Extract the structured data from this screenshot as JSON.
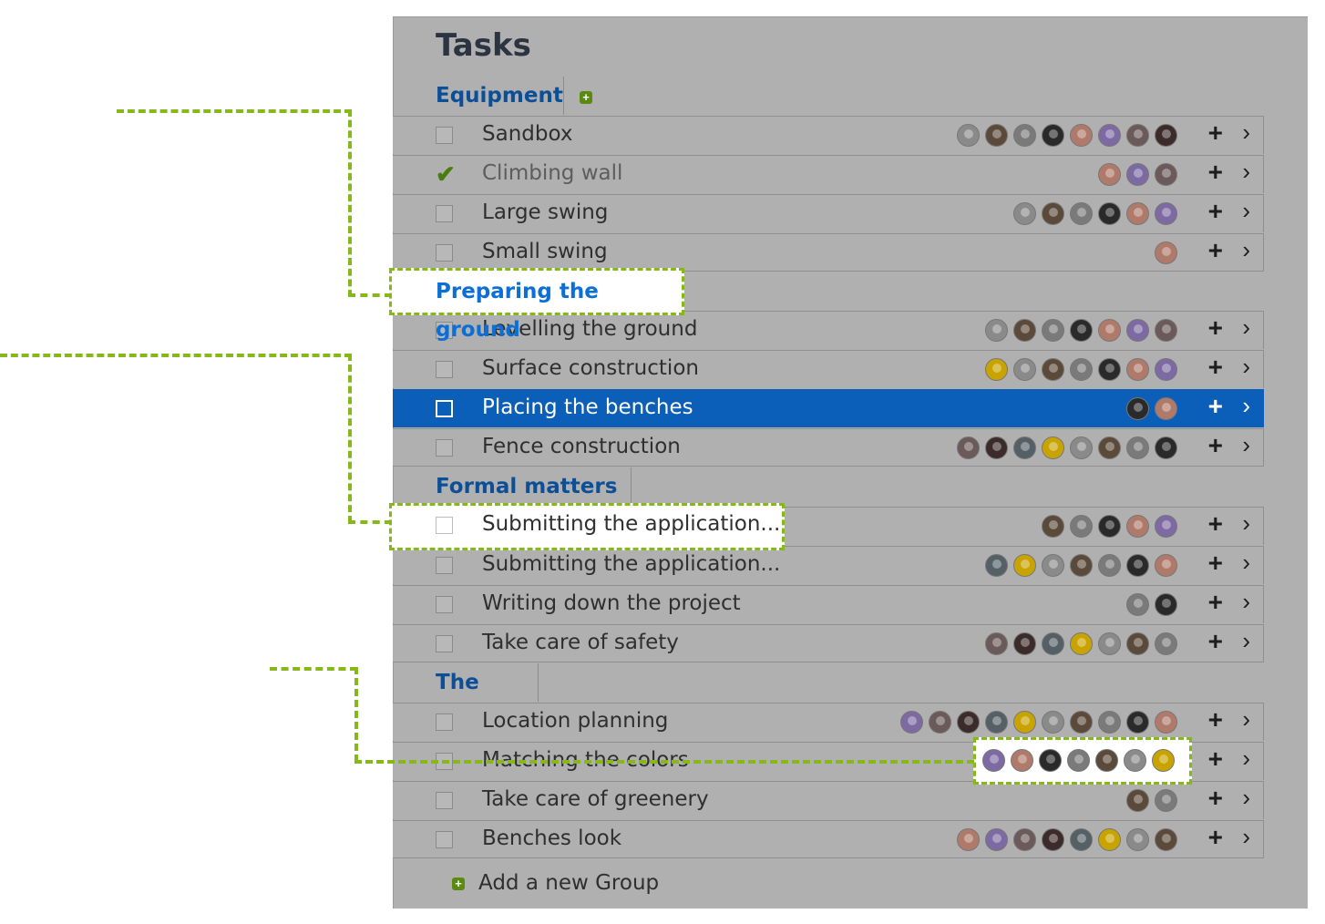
{
  "title": "Tasks",
  "colors": {
    "accent": "#86b81c",
    "selected": "#0b5fb8",
    "group": "#0d4f97"
  },
  "icons": {
    "add_group": "plus-square-icon",
    "add_task": "plus-icon",
    "open": "chevron-right-icon",
    "done": "check-icon"
  },
  "groups": [
    {
      "name": "Equipment",
      "tasks": [
        {
          "name": "Sandbox",
          "done": false,
          "avatars": 8
        },
        {
          "name": "Climbing wall",
          "done": true,
          "avatars": 3
        },
        {
          "name": "Large swing",
          "done": false,
          "avatars": 6
        },
        {
          "name": "Small swing",
          "done": false,
          "avatars": 1
        }
      ]
    },
    {
      "name": "Preparing the ground",
      "tasks": [
        {
          "name": "Levelling the ground",
          "done": false,
          "avatars": 7
        },
        {
          "name": "Surface construction",
          "done": false,
          "avatars": 7
        },
        {
          "name": "Placing the benches",
          "done": false,
          "selected": true,
          "avatars": 2
        },
        {
          "name": "Fence construction",
          "done": false,
          "avatars": 8
        }
      ]
    },
    {
      "name": "Formal matters",
      "tasks": [
        {
          "name": "Submitting the application...",
          "done": false,
          "avatars": 5
        },
        {
          "name": "Submitting the application...",
          "done": false,
          "avatars": 7
        },
        {
          "name": "Writing down the project",
          "done": false,
          "avatars": 2
        },
        {
          "name": "Take care of safety",
          "done": false,
          "avatars": 7
        }
      ]
    },
    {
      "name": "The Look",
      "tasks": [
        {
          "name": "Location planning",
          "done": false,
          "avatars": 10
        },
        {
          "name": "Matching the colors",
          "done": false,
          "avatars": 7
        },
        {
          "name": "Take care of greenery",
          "done": false,
          "avatars": 2
        },
        {
          "name": "Benches look",
          "done": false,
          "avatars": 8
        }
      ]
    }
  ],
  "add_group_label": "Add a new Group"
}
